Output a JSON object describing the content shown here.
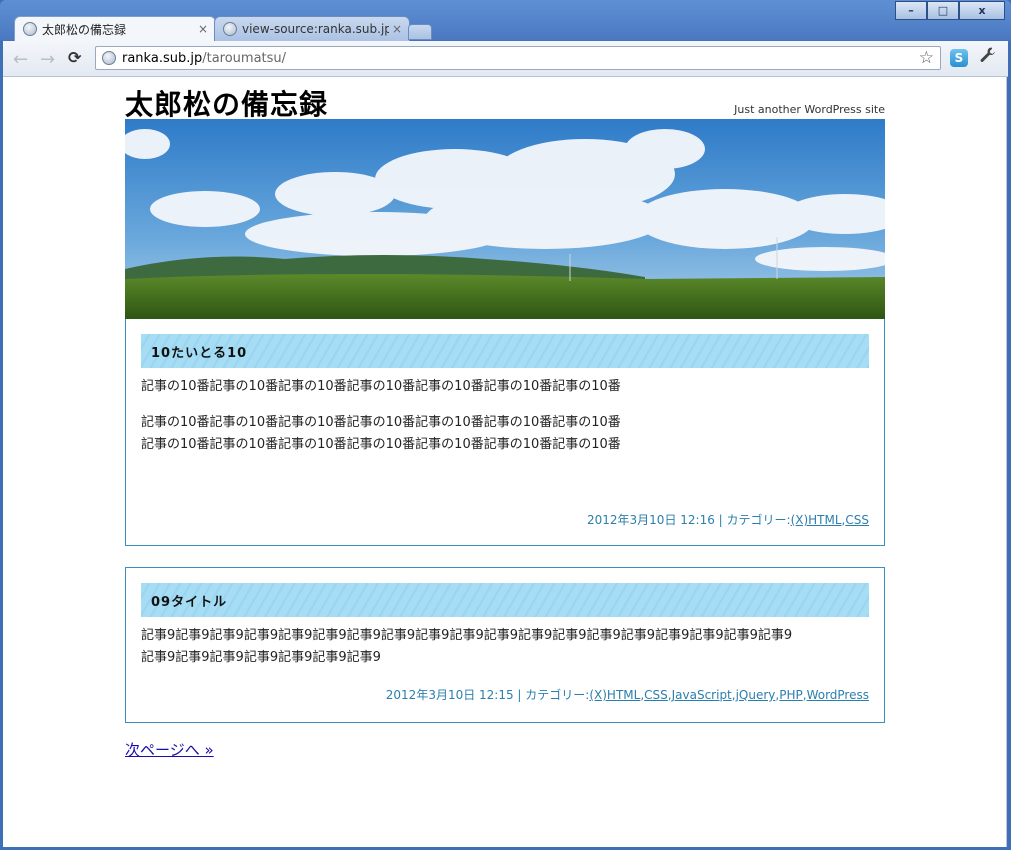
{
  "window": {
    "controls": {
      "minimize": "–",
      "maximize": "□",
      "close": "x"
    }
  },
  "tabs": [
    {
      "title": "太郎松の備忘録",
      "icon": "globe-icon",
      "active": true
    },
    {
      "title": "view-source:ranka.sub.jp/tar",
      "icon": "globe-icon",
      "active": false
    }
  ],
  "toolbar": {
    "back_icon": "←",
    "forward_icon": "→",
    "reload_icon": "C",
    "url_host": "ranka.sub.jp",
    "url_path": "/taroumatsu/",
    "star_icon": "☆",
    "extension_label": "S",
    "wrench_icon": "🔧"
  },
  "site": {
    "title": "太郎松の備忘録",
    "description": "Just another WordPress site"
  },
  "posts": [
    {
      "title": "10たいとる10",
      "paragraphs": [
        "記事の10番記事の10番記事の10番記事の10番記事の10番記事の10番記事の10番",
        "記事の10番記事の10番記事の10番記事の10番記事の10番記事の10番記事の10番",
        "記事の10番記事の10番記事の10番記事の10番記事の10番記事の10番記事の10番"
      ],
      "meta_prefix": "2012年3月10日 12:16 | カテゴリー:",
      "categories": [
        "(X)HTML",
        "CSS"
      ]
    },
    {
      "title": "09タイトル",
      "paragraphs": [
        "記事9記事9記事9記事9記事9記事9記事9記事9記事9記事9記事9記事9記事9記事9記事9記事9記事9記事9記事9",
        "記事9記事9記事9記事9記事9記事9記事9"
      ],
      "meta_prefix": "2012年3月10日 12:15 | カテゴリー:",
      "categories": [
        "(X)HTML",
        "CSS",
        "JavaScript",
        "jQuery",
        "PHP",
        "WordPress"
      ]
    }
  ],
  "pagination": {
    "next_label": "次ページへ »"
  },
  "colors": {
    "accent": "#2b7fae",
    "title_bar": "#a6dcf4",
    "border": "#3a8fbf"
  }
}
